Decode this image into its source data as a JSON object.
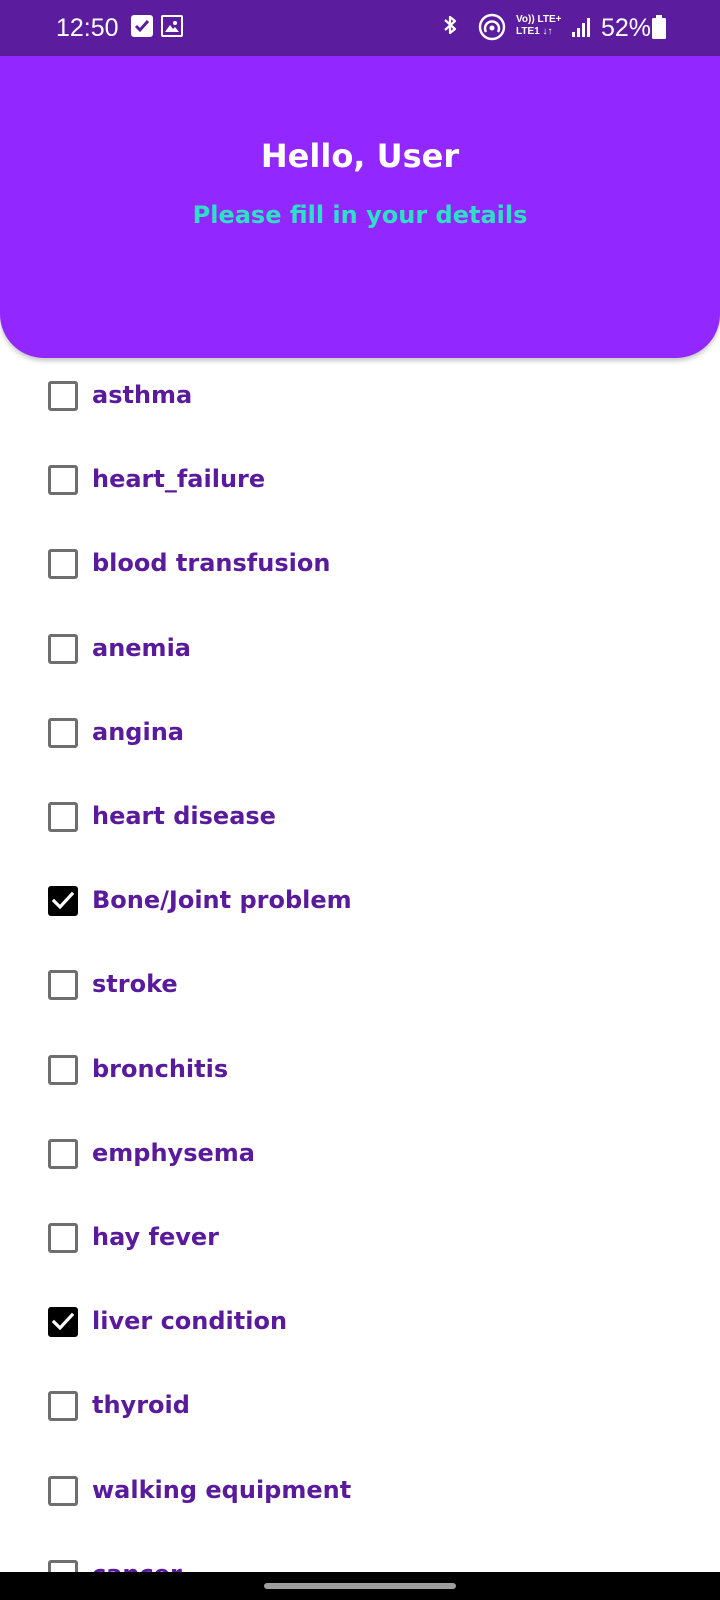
{
  "status_bar": {
    "time": "12:50",
    "battery": "52%",
    "network_top": "Vo)) LTE+",
    "network_bottom": "LTE1 ↓↑",
    "icons": [
      "check-notification-icon",
      "image-notification-icon",
      "bluetooth-icon",
      "hotspot-icon",
      "volte-icon",
      "signal-icon",
      "battery-icon"
    ],
    "background_color": "#5b1d9e"
  },
  "header": {
    "title": "Hello, User",
    "subtitle": "Please fill in your details",
    "background_color": "#9327ff",
    "subtitle_color": "#2de0c6"
  },
  "conditions": [
    {
      "label": "asthma",
      "checked": false
    },
    {
      "label": "heart_failure",
      "checked": false
    },
    {
      "label": "blood transfusion",
      "checked": false
    },
    {
      "label": "anemia",
      "checked": false
    },
    {
      "label": "angina",
      "checked": false
    },
    {
      "label": "heart disease",
      "checked": false
    },
    {
      "label": "Bone/Joint problem",
      "checked": true
    },
    {
      "label": "stroke",
      "checked": false
    },
    {
      "label": "bronchitis",
      "checked": false
    },
    {
      "label": "emphysema",
      "checked": false
    },
    {
      "label": "hay fever",
      "checked": false
    },
    {
      "label": "liver condition",
      "checked": true
    },
    {
      "label": "thyroid",
      "checked": false
    },
    {
      "label": "walking equipment",
      "checked": false
    },
    {
      "label": "cancer",
      "checked": false
    }
  ],
  "colors": {
    "label": "#5a1a9c",
    "checkbox_unchecked": "#6e6e6e",
    "checkbox_checked": "#000000"
  }
}
